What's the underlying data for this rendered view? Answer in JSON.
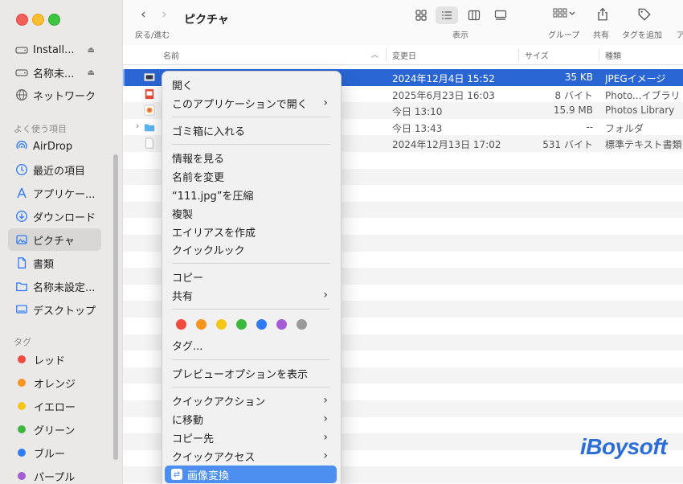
{
  "window": {
    "title": "ピクチャ",
    "nav_caption": "戻る/進む",
    "back_label": "‹",
    "forward_label": "›"
  },
  "toolbar": {
    "view_caption": "表示",
    "group_caption": "グループ",
    "share_caption": "共有",
    "tag_caption": "タグを追加",
    "action_caption": "ア"
  },
  "sidebar": {
    "devices": [
      {
        "label": "Install...",
        "icon": "drive-icon"
      },
      {
        "label": "名称未...",
        "icon": "drive-icon"
      },
      {
        "label": "ネットワーク",
        "icon": "network-icon"
      }
    ],
    "favorites_header": "よく使う項目",
    "favorites": [
      {
        "label": "AirDrop",
        "icon": "airdrop-icon"
      },
      {
        "label": "最近の項目",
        "icon": "clock-icon"
      },
      {
        "label": "アプリケー...",
        "icon": "applications-icon"
      },
      {
        "label": "ダウンロード",
        "icon": "download-icon"
      },
      {
        "label": "ピクチャ",
        "icon": "pictures-icon",
        "selected": true
      },
      {
        "label": "書類",
        "icon": "document-icon"
      },
      {
        "label": "名称未設定...",
        "icon": "folder-icon"
      },
      {
        "label": "デスクトップ",
        "icon": "desktop-icon"
      }
    ],
    "tags_header": "タグ",
    "tags": [
      {
        "label": "レッド",
        "color": "#f0493e"
      },
      {
        "label": "オレンジ",
        "color": "#f7941d"
      },
      {
        "label": "イエロー",
        "color": "#f5c518"
      },
      {
        "label": "グリーン",
        "color": "#3cb83c"
      },
      {
        "label": "ブルー",
        "color": "#2f7bf5"
      },
      {
        "label": "パープル",
        "color": "#a55bd6"
      }
    ]
  },
  "columns": {
    "name": "名前",
    "date": "変更日",
    "size": "サイズ",
    "kind": "種類"
  },
  "files": [
    {
      "date": "2024年12月4日 15:52",
      "size": "35 KB",
      "kind": "JPEGイメージ",
      "selected": true
    },
    {
      "date": "2025年6月23日 16:03",
      "size": "8 バイト",
      "kind": "Photo...イブラリ"
    },
    {
      "date": "今日 13:10",
      "size": "15.9 MB",
      "kind": "Photos Library"
    },
    {
      "date": "今日 13:43",
      "size": "--",
      "kind": "フォルダ"
    },
    {
      "date": "2024年12月13日 17:02",
      "size": "531 バイト",
      "kind": "標準テキスト書類"
    }
  ],
  "context_menu": {
    "open": "開く",
    "open_with": "このアプリケーションで開く",
    "trash": "ゴミ箱に入れる",
    "get_info": "情報を見る",
    "rename": "名前を変更",
    "compress": "“111.jpg”を圧縮",
    "duplicate": "複製",
    "make_alias": "エイリアスを作成",
    "quick_look": "クイックルック",
    "copy": "コピー",
    "share": "共有",
    "tag_colors": [
      "#f0493e",
      "#f7941d",
      "#f5c518",
      "#3cb83c",
      "#2f7bf5",
      "#a55bd6",
      "#9a9a9a"
    ],
    "tags": "タグ...",
    "preview_options": "プレビューオプションを表示",
    "quick_actions": "クイックアクション",
    "move_to": "に移動",
    "copy_to": "コピー先",
    "quick_access": "クイックアクセス",
    "convert_image": "画像変換"
  },
  "watermark": "iBoysoft"
}
